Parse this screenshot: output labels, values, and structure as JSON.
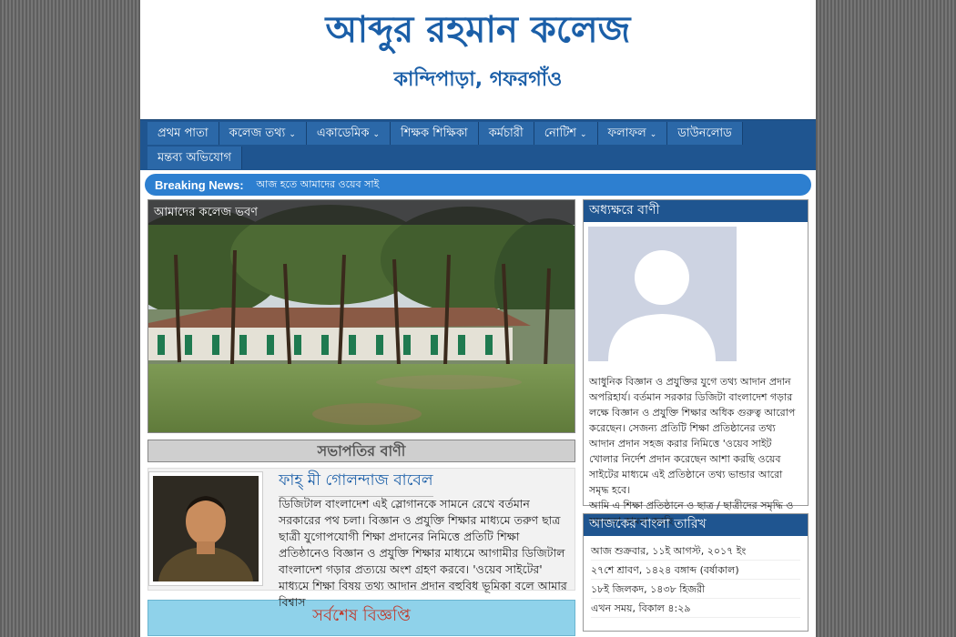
{
  "header": {
    "title": "আব্দুর রহমান কলেজ",
    "subtitle": "কান্দিপাড়া, গফরগাঁও"
  },
  "nav": {
    "row1": [
      {
        "label": "প্রথম পাতা",
        "dropdown": false
      },
      {
        "label": "কলেজ তথ্য",
        "dropdown": true
      },
      {
        "label": "একাডেমিক",
        "dropdown": true
      },
      {
        "label": "শিক্ষক শিক্ষিকা",
        "dropdown": false
      },
      {
        "label": "কর্মচারী",
        "dropdown": false
      },
      {
        "label": "নোটিশ",
        "dropdown": true
      },
      {
        "label": "ফলাফল",
        "dropdown": true
      },
      {
        "label": "ডাউনলোড",
        "dropdown": false
      }
    ],
    "row2": [
      {
        "label": "মন্তব্য অভিযোগ",
        "dropdown": false
      }
    ],
    "chevron": "⌄"
  },
  "ticker": {
    "label": "Breaking News:",
    "text": "আজ হতে আমাদের ওয়েব সাই"
  },
  "slider": {
    "caption": "আমাদের কলেজ ভবণ"
  },
  "chairman": {
    "heading": "সভাপতির বাণী",
    "name": "ফাহ্ মী গোলন্দাজ বাবেল",
    "message": "ডিজিটাল বাংলাদেশ এই স্লোগানকে সামনে রেখে বর্তমান সরকারের পথ চলা। বিজ্ঞান ও প্রযুক্তি শিক্ষার মাধ্যমে তরুণ ছাত্র ছাত্রী যুগোপযোগী শিক্ষা প্রদানের নিমিত্তে প্রতিটি শিক্ষা প্রতিষ্ঠানেও বিজ্ঞান ও প্রযুক্তি শিক্ষার মাধ্যমে আগামীর ডিজিটাল বাংলাদেশ গড়ার প্রত্যয়ে অংশ গ্রহণ করবে। 'ওয়েব সাইটের' মাধ্যমে শিক্ষা বিষয় তথ্য আদান প্রদান বহুবিধ ভূমিকা বলে আমার বিশ্বাস"
  },
  "notice": {
    "heading": "সর্বশেষ বিজ্ঞপ্তি"
  },
  "principal": {
    "title": "অধ্যক্ষরে বাণী",
    "message": "আধুনিক বিজ্ঞান ও প্রযুক্তির যুগে তথ্য আদান প্রদান অপরিহার্য। বর্তমান সরকার ডিজিটা বাংলাদেশ গড়ার লক্ষে বিজ্ঞান ও প্রযুক্তি শিক্ষার অধিক গুরুত্ব আরোপ করেছেন। সেজন্য প্রতিটি শিক্ষা প্রতিষ্ঠানের তথ্য আদান প্রদান সহজ করার নিমিত্তে 'ওয়েব সাইট খোলার নির্দেশ প্রদান করেছেন আশা করছি ওয়েব সাইটের মাধ্যমে এই প্রতিষ্ঠানে তথ্য ভান্ডার আরো সমৃদ্ধ হবে।",
    "message2": "আমি এ শিক্ষা প্রতিষ্ঠানে ও ছাত্র / ছাত্রীদের সমৃদ্ধি ও সফলতা কামনা করছি"
  },
  "date_widget": {
    "title": "আজকের বাংলা তারিখ",
    "lines": [
      "আজ শুক্রবার, ১১ই আগস্ট, ২০১৭ ইং",
      "২৭শে শ্রাবণ, ১৪২৪ বঙ্গাব্দ (বর্ষাকাল)",
      "১৮ই জিলকদ, ১৪৩৮ হিজরী",
      "এখন সময়, বিকাল ৪:২৯"
    ]
  }
}
